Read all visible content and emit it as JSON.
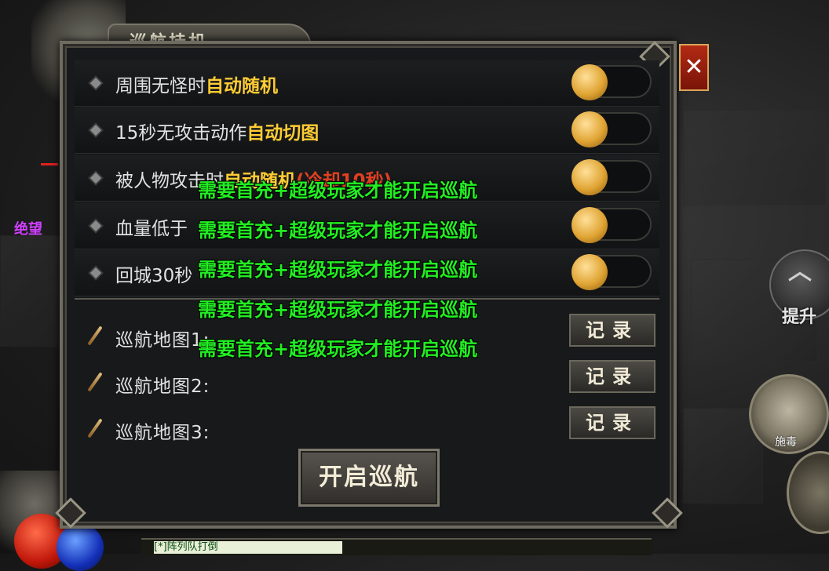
{
  "title": "巡航挂机",
  "close_label": "✕",
  "options": [
    {
      "label": "周围无怪时",
      "highlight": "自动随机",
      "tail": "",
      "enabled": false
    },
    {
      "label": "15秒无攻击动作",
      "highlight": "自动切图",
      "tail": "",
      "enabled": false
    },
    {
      "label": "被人物攻击时",
      "highlight": "自动随机",
      "tail": "(冷却10秒)",
      "enabled": false
    },
    {
      "label": "血量低于",
      "highlight": "",
      "tail": "",
      "enabled": false
    },
    {
      "label": "回城30秒",
      "highlight": "",
      "tail": "",
      "enabled": false
    }
  ],
  "maps": [
    {
      "label": "巡航地图1:",
      "button": "记录"
    },
    {
      "label": "巡航地图2:",
      "button": "记录"
    },
    {
      "label": "巡航地图3:",
      "button": "记录"
    }
  ],
  "start_button": "开启巡航",
  "notices": [
    "需要首充+超级玩家才能开启巡航",
    "需要首充+超级玩家才能开启巡航",
    "需要首充+超级玩家才能开启巡航",
    "需要首充+超级玩家才能开启巡航",
    "需要首充+超级玩家才能开启巡航"
  ],
  "hud": {
    "upgrade_label": "提升",
    "poison_label": "施毒",
    "player_name": "绝望",
    "chat_preview": "[*]阵列队打倒"
  },
  "colors": {
    "highlight": "#ffcc33",
    "notice": "#22ee22",
    "knob": "#e0a534",
    "close": "#b22a14"
  }
}
